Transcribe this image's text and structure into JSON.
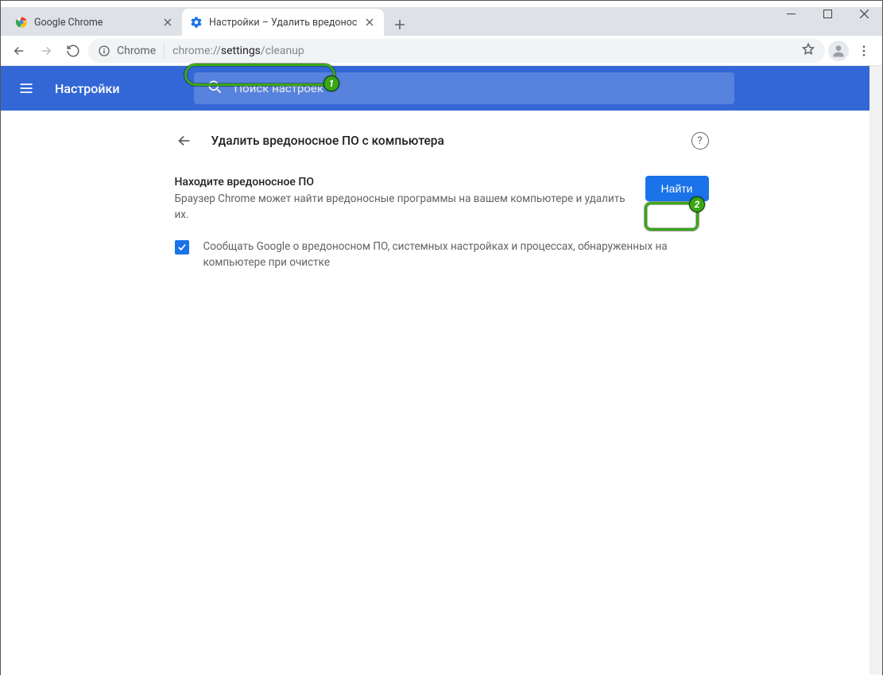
{
  "window": {
    "tabs": [
      {
        "title": "Google Chrome",
        "active": false
      },
      {
        "title": "Настройки – Удалить вредонос",
        "active": true
      }
    ]
  },
  "toolbar": {
    "site_label": "Chrome",
    "url_dim_prefix": "chrome://",
    "url_dark": "settings",
    "url_dim_suffix": "/cleanup"
  },
  "settings_header": {
    "title": "Настройки",
    "search_placeholder": "Поиск настроек"
  },
  "page": {
    "title": "Удалить вредоносное ПО с компьютера",
    "section": {
      "title": "Находите вредоносное ПО",
      "desc": "Браузер Chrome может найти вредоносные программы на вашем компьютере и удалить их.",
      "button": "Найти"
    },
    "checkbox": {
      "checked": true,
      "label": "Сообщать Google о вредоносном ПО, системных настройках и процессах, обнаруженных на компьютере при очистке"
    }
  },
  "annotations": {
    "badge1": "1",
    "badge2": "2"
  }
}
